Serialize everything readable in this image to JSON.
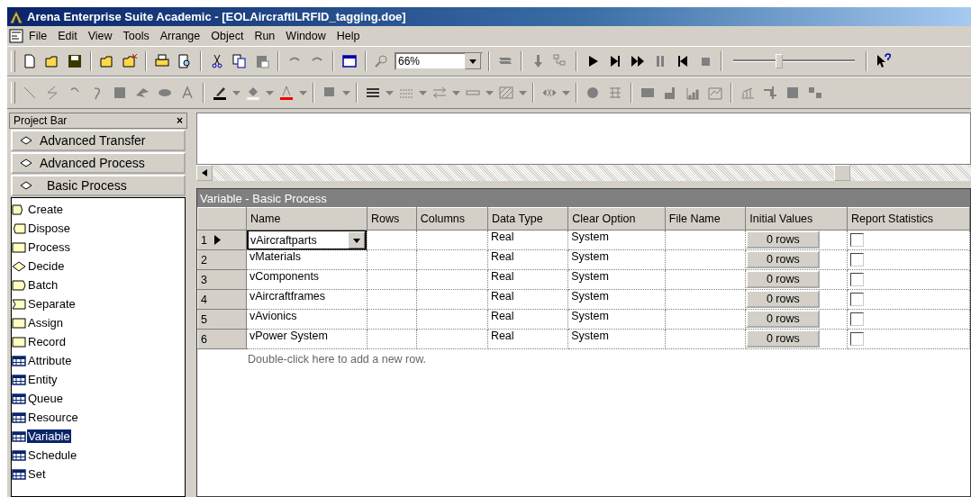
{
  "window": {
    "title": "Arena Enterprise Suite Academic - [EOLAircraftILRFID_tagging.doe]"
  },
  "menu": [
    "File",
    "Edit",
    "View",
    "Tools",
    "Arrange",
    "Object",
    "Run",
    "Window",
    "Help"
  ],
  "toolbar": {
    "zoom_value": "66%",
    "speed_slider": {
      "level": 0.37
    }
  },
  "project_bar": {
    "title": "Project Bar",
    "close": "×",
    "panels": [
      {
        "label": "Advanced Transfer",
        "expanded": false
      },
      {
        "label": "Advanced Process",
        "expanded": false
      },
      {
        "label": "Basic Process",
        "expanded": true
      }
    ],
    "modules": [
      {
        "label": "Create",
        "kind": "create",
        "selected": false
      },
      {
        "label": "Dispose",
        "kind": "dispose",
        "selected": false
      },
      {
        "label": "Process",
        "kind": "process",
        "selected": false
      },
      {
        "label": "Decide",
        "kind": "decide",
        "selected": false
      },
      {
        "label": "Batch",
        "kind": "batch",
        "selected": false
      },
      {
        "label": "Separate",
        "kind": "separate",
        "selected": false
      },
      {
        "label": "Assign",
        "kind": "process",
        "selected": false
      },
      {
        "label": "Record",
        "kind": "process",
        "selected": false
      },
      {
        "label": "Attribute",
        "kind": "data",
        "selected": false
      },
      {
        "label": "Entity",
        "kind": "data",
        "selected": false
      },
      {
        "label": "Queue",
        "kind": "data",
        "selected": false
      },
      {
        "label": "Resource",
        "kind": "data",
        "selected": false
      },
      {
        "label": "Variable",
        "kind": "data",
        "selected": true
      },
      {
        "label": "Schedule",
        "kind": "data",
        "selected": false
      },
      {
        "label": "Set",
        "kind": "data",
        "selected": false
      }
    ]
  },
  "spreadsheet": {
    "title": "Variable - Basic Process",
    "columns": [
      "Name",
      "Rows",
      "Columns",
      "Data Type",
      "Clear Option",
      "File Name",
      "Initial Values",
      "Report Statistics"
    ],
    "rows": [
      {
        "number": "1",
        "selected": true,
        "name": "vAircraftparts",
        "rows": "",
        "columns": "",
        "data_type": "Real",
        "clear_option": "System",
        "file_name": "",
        "initial_values": "0 rows",
        "report_statistics": false
      },
      {
        "number": "2",
        "selected": false,
        "name": "vMaterials",
        "rows": "",
        "columns": "",
        "data_type": "Real",
        "clear_option": "System",
        "file_name": "",
        "initial_values": "0 rows",
        "report_statistics": false
      },
      {
        "number": "3",
        "selected": false,
        "name": "vComponents",
        "rows": "",
        "columns": "",
        "data_type": "Real",
        "clear_option": "System",
        "file_name": "",
        "initial_values": "0 rows",
        "report_statistics": false
      },
      {
        "number": "4",
        "selected": false,
        "name": "vAircraftframes",
        "rows": "",
        "columns": "",
        "data_type": "Real",
        "clear_option": "System",
        "file_name": "",
        "initial_values": "0 rows",
        "report_statistics": false
      },
      {
        "number": "5",
        "selected": false,
        "name": "vAvionics",
        "rows": "",
        "columns": "",
        "data_type": "Real",
        "clear_option": "System",
        "file_name": "",
        "initial_values": "0 rows",
        "report_statistics": false
      },
      {
        "number": "6",
        "selected": false,
        "name": "vPower System",
        "rows": "",
        "columns": "",
        "data_type": "Real",
        "clear_option": "System",
        "file_name": "",
        "initial_values": "0 rows",
        "report_statistics": false
      }
    ],
    "add_row_hint": "Double-click here to add a new row."
  }
}
